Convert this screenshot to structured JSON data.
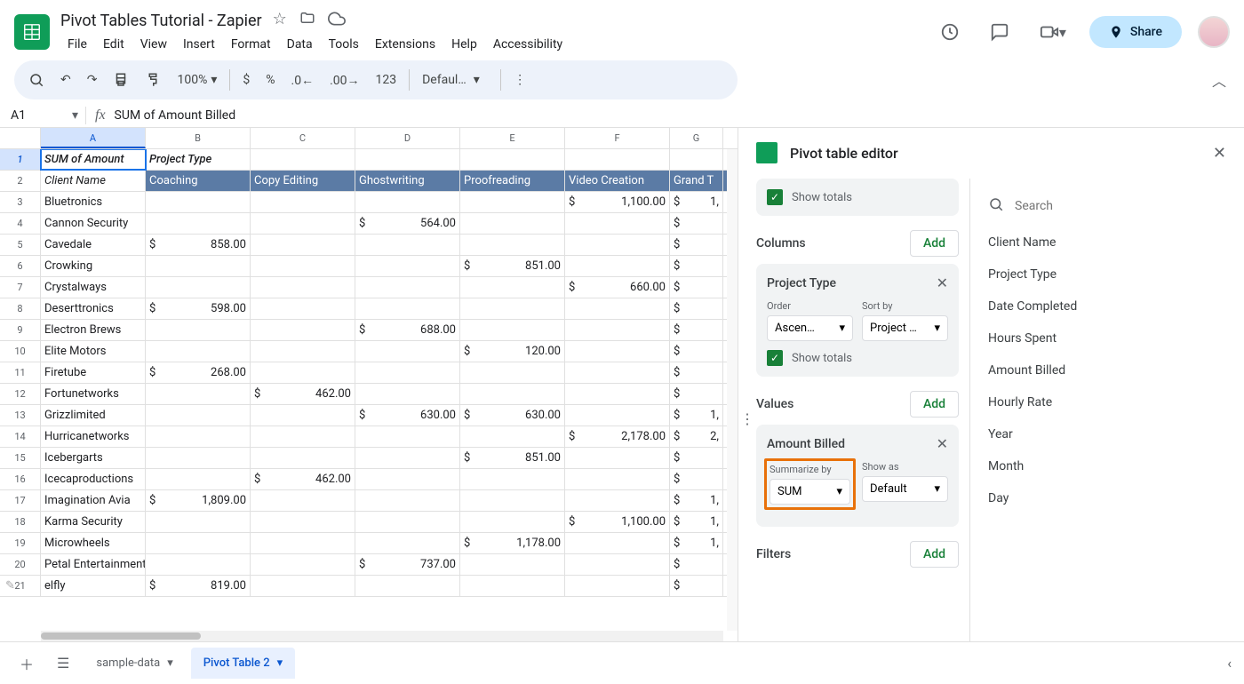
{
  "doc": {
    "title": "Pivot Tables Tutorial - Zapier"
  },
  "menus": [
    "File",
    "Edit",
    "View",
    "Insert",
    "Format",
    "Data",
    "Tools",
    "Extensions",
    "Help",
    "Accessibility"
  ],
  "share": "Share",
  "toolbar": {
    "zoom": "100%",
    "font": "Defaul…",
    "numfmt": "123"
  },
  "namebox": "A1",
  "formula": "SUM of  Amount Billed",
  "columns": [
    "A",
    "B",
    "C",
    "D",
    "E",
    "F",
    "G"
  ],
  "pivot_headers": {
    "r1c1": "SUM of  Amount",
    "r1c2": "Project Type",
    "r2c1": "Client Name"
  },
  "col_labels": [
    "Coaching",
    "Copy Editing",
    "Ghostwriting",
    "Proofreading",
    "Video Creation",
    "Grand T"
  ],
  "rows": [
    {
      "n": 3,
      "name": "Bluetronics",
      "vals": [
        "",
        "",
        "",
        "",
        "1,100.00",
        "1,"
      ]
    },
    {
      "n": 4,
      "name": "Cannon Security",
      "vals": [
        "",
        "",
        "564.00",
        "",
        "",
        ""
      ]
    },
    {
      "n": 5,
      "name": "Cavedale",
      "vals": [
        "858.00",
        "",
        "",
        "",
        "",
        ""
      ]
    },
    {
      "n": 6,
      "name": "Crowking",
      "vals": [
        "",
        "",
        "",
        "851.00",
        "",
        ""
      ]
    },
    {
      "n": 7,
      "name": "Crystalways",
      "vals": [
        "",
        "",
        "",
        "",
        "660.00",
        ""
      ]
    },
    {
      "n": 8,
      "name": "Deserttronics",
      "vals": [
        "598.00",
        "",
        "",
        "",
        "",
        ""
      ]
    },
    {
      "n": 9,
      "name": "Electron Brews",
      "vals": [
        "",
        "",
        "688.00",
        "",
        "",
        ""
      ]
    },
    {
      "n": 10,
      "name": "Elite Motors",
      "vals": [
        "",
        "",
        "",
        "120.00",
        "",
        ""
      ]
    },
    {
      "n": 11,
      "name": "Firetube",
      "vals": [
        "268.00",
        "",
        "",
        "",
        "",
        ""
      ]
    },
    {
      "n": 12,
      "name": "Fortunetworks",
      "vals": [
        "",
        "462.00",
        "",
        "",
        "",
        ""
      ]
    },
    {
      "n": 13,
      "name": "Grizzlimited",
      "vals": [
        "",
        "",
        "630.00",
        "630.00",
        "",
        "1,"
      ]
    },
    {
      "n": 14,
      "name": "Hurricanetworks",
      "vals": [
        "",
        "",
        "",
        "",
        "2,178.00",
        "2,"
      ]
    },
    {
      "n": 15,
      "name": "Icebergarts",
      "vals": [
        "",
        "",
        "",
        "851.00",
        "",
        ""
      ]
    },
    {
      "n": 16,
      "name": "Icecaproductions",
      "vals": [
        "",
        "462.00",
        "",
        "",
        "",
        ""
      ]
    },
    {
      "n": 17,
      "name": "Imagination Avia",
      "vals": [
        "1,809.00",
        "",
        "",
        "",
        "",
        "1,"
      ]
    },
    {
      "n": 18,
      "name": "Karma Security",
      "vals": [
        "",
        "",
        "",
        "",
        "1,100.00",
        "1,"
      ]
    },
    {
      "n": 19,
      "name": "Microwheels",
      "vals": [
        "",
        "",
        "",
        "1,178.00",
        "",
        "1,"
      ]
    },
    {
      "n": 20,
      "name": "Petal Entertainment",
      "vals": [
        "",
        "",
        "737.00",
        "",
        "",
        ""
      ]
    },
    {
      "n": 21,
      "name": "elfly",
      "vals": [
        "819.00",
        "",
        "",
        "",
        "",
        ""
      ]
    }
  ],
  "editor": {
    "title": "Pivot table editor",
    "show_totals": "Show totals",
    "sections": {
      "columns": "Columns",
      "values": "Values",
      "filters": "Filters"
    },
    "add": "Add",
    "col_card": {
      "title": "Project Type",
      "order_label": "Order",
      "order_val": "Ascen…",
      "sort_label": "Sort by",
      "sort_val": "Project …"
    },
    "val_card": {
      "title": "Amount Billed",
      "sum_label": "Summarize by",
      "sum_val": "SUM",
      "show_label": "Show as",
      "show_val": "Default"
    },
    "search_placeholder": "Search",
    "fields": [
      "Client Name",
      "Project Type",
      "Date Completed",
      "Hours Spent",
      "Amount Billed",
      "Hourly Rate",
      "Year",
      "Month",
      "Day"
    ]
  },
  "tabs": {
    "sample": "sample-data",
    "pivot": "Pivot Table 2"
  }
}
